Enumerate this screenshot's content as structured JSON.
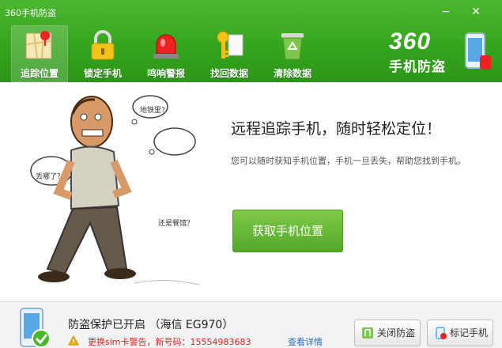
{
  "window": {
    "title": "360手机防盗",
    "minimize": "−",
    "close": "✕"
  },
  "nav": [
    {
      "label": "追踪位置",
      "icon": "map-pin-icon"
    },
    {
      "label": "锁定手机",
      "icon": "padlock-icon"
    },
    {
      "label": "鸣响警报",
      "icon": "siren-icon"
    },
    {
      "label": "找回数据",
      "icon": "key-icon"
    },
    {
      "label": "清除数据",
      "icon": "recycle-bin-icon"
    }
  ],
  "logo": {
    "number": "360",
    "subtitle": "手机防盗"
  },
  "main": {
    "headline": "远程追踪手机，随时轻松定位！",
    "description": "您可以随时获知手机位置，手机一旦丢失，帮助您找到手机。",
    "button": "获取手机位置",
    "bubbles": [
      "丢哪了？",
      "地铁里？",
      "还是餐馆？"
    ]
  },
  "footer": {
    "status": "防盗保护已开启 （海信 EG970）",
    "warning": "更换sim卡警告，新号码：15554983683",
    "detail_link": "查看详情",
    "close_button": "关闭防盗",
    "mark_button": "标记手机"
  },
  "colors": {
    "header_green": "#34a41d",
    "button_green": "#55a828",
    "warning_red": "#e02020",
    "link_blue": "#2a6fc0"
  }
}
